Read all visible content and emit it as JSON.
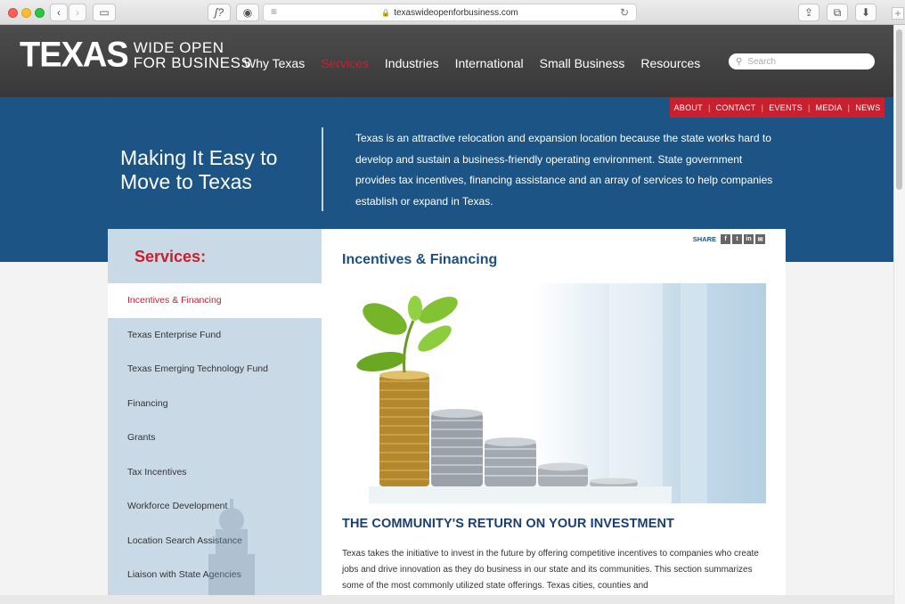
{
  "browser": {
    "url": "texaswideopenforbusiness.com",
    "buttons": {
      "back": "‹",
      "forward": "›",
      "sidebar": "▭",
      "script": "ʃ?",
      "shield": "◉",
      "share": "⇪",
      "tabs": "⧉",
      "download": "⬇",
      "newtab": "+"
    }
  },
  "header": {
    "logo_main": "TEXAS",
    "logo_wide_open": "WIDE OPEN",
    "logo_for_business": "FOR BUSINESS",
    "nav": [
      "Why Texas",
      "Services",
      "Industries",
      "International",
      "Small Business",
      "Resources"
    ],
    "nav_active_index": 1,
    "search_placeholder": "Search"
  },
  "utility_nav": [
    "ABOUT",
    "CONTACT",
    "EVENTS",
    "MEDIA",
    "NEWS"
  ],
  "hero": {
    "title": "Making It Easy to Move to Texas",
    "text": "Texas is an attractive relocation and expansion location because the state works hard to develop and sustain a business-friendly operating environment. State government provides tax incentives, financing assistance and an array of services to help companies establish or expand in Texas."
  },
  "sidebar": {
    "title": "Services:",
    "items": [
      "Incentives & Financing",
      "Texas Enterprise Fund",
      "Texas Emerging Technology Fund",
      "Financing",
      "Grants",
      "Tax Incentives",
      "Workforce Development",
      "Location Search Assistance",
      "Liaison with State Agencies"
    ],
    "active_index": 0
  },
  "main": {
    "share_label": "SHARE",
    "share_icons": [
      "f",
      "t",
      "in",
      "✉"
    ],
    "title": "Incentives & Financing",
    "sub_heading": "THE COMMUNITY'S RETURN ON YOUR INVESTMENT",
    "body": "Texas takes the initiative to invest in the future by offering competitive incentives to companies who create jobs and drive innovation as they do business in our state and its communities. This section summarizes some of the most commonly utilized state offerings. Texas cities, counties and"
  },
  "colors": {
    "brand_red": "#c8202f",
    "brand_blue": "#1c5486",
    "header_dark": "#404040",
    "sidebar_bg": "#c9d9e6"
  }
}
